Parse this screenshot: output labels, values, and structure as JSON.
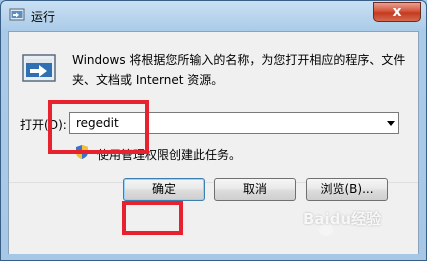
{
  "window": {
    "title": "运行",
    "close_symbol": "x"
  },
  "dialog": {
    "description": "Windows 将根据您所输入的名称，为您打开相应的程序、文件夹、文档或 Internet 资源。",
    "open_label": "打开(O):",
    "open_value": "regedit",
    "admin_note": "使用管理权限创建此任务。"
  },
  "buttons": {
    "ok": "确定",
    "cancel": "取消",
    "browse": "浏览(B)..."
  },
  "watermark": {
    "text": "Baidu经验"
  },
  "colors": {
    "highlight": "#e8212e",
    "close": "#c33a1f"
  }
}
